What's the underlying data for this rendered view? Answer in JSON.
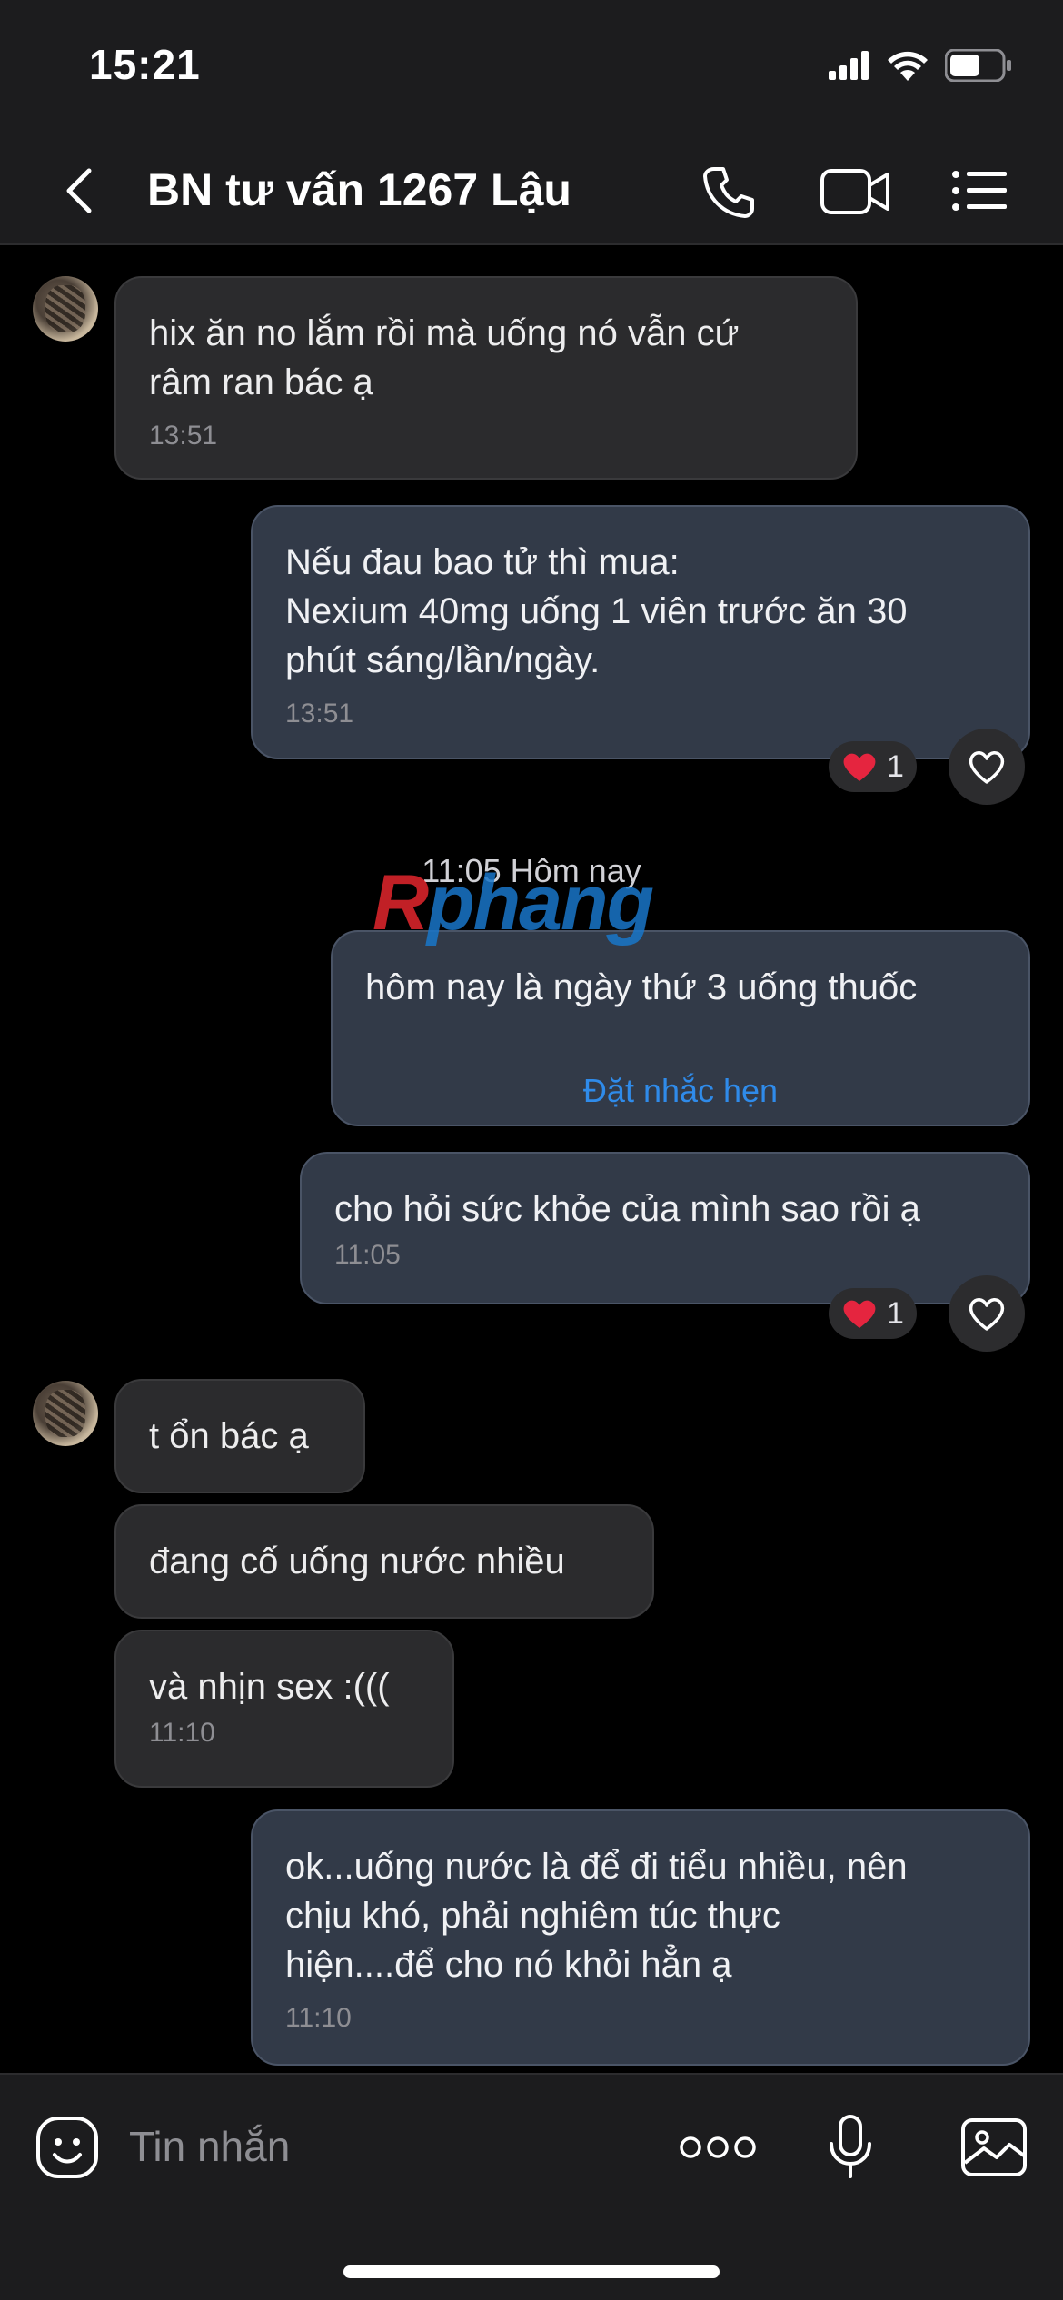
{
  "status": {
    "time": "15:21"
  },
  "header": {
    "title": "BN tư vấn 1267 Lậu"
  },
  "messages": [
    {
      "text": "hix ăn no lắm rồi mà uống nó vẫn cứ\nrâm ran bác ạ",
      "time": "13:51"
    },
    {
      "text": "Nếu đau bao tử thì mua:\nNexium 40mg uống 1 viên trước ăn 30\nphút sáng/lần/ngày.",
      "time": "13:51",
      "reaction_count": "1"
    },
    {
      "date_separator": "11:05 Hôm nay"
    },
    {
      "text": "hôm nay là ngày thứ 3 uống thuốc",
      "action": "Đặt nhắc hẹn"
    },
    {
      "text": "cho hỏi sức khỏe của mình sao rồi ạ",
      "time": "11:05",
      "reaction_count": "1"
    },
    {
      "text": "t ổn bác ạ"
    },
    {
      "text": "đang cố uống nước nhiều"
    },
    {
      "text": "và nhịn sex :(((",
      "time": "11:10"
    },
    {
      "text": "ok...uống nước là để đi tiểu nhiều, nên\nchịu khó, phải nghiêm túc thực\nhiện....để cho nó khỏi hẳn ạ",
      "time": "11:10"
    }
  ],
  "watermark": {
    "red": "R",
    "blue": "phang"
  },
  "input": {
    "placeholder": "Tin nhắn"
  },
  "colors": {
    "outgoing_bubble": "#323a48",
    "incoming_bubble": "#2b2b2d",
    "link": "#2f8bea",
    "heart": "#e5253f"
  },
  "icons": [
    "back-arrow-icon",
    "phone-icon",
    "video-icon",
    "menu-list-icon",
    "heart-icon",
    "sticker-icon",
    "more-icon",
    "microphone-icon",
    "image-icon",
    "signal-icon",
    "wifi-icon",
    "battery-icon"
  ]
}
